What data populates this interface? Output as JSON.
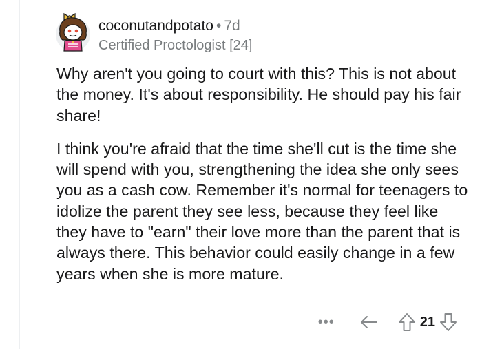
{
  "comment": {
    "username": "coconutandpotato",
    "separator": "•",
    "age": "7d",
    "flair": "Certified Proctologist [24]",
    "paragraphs": [
      "Why aren't you going to court with this? This is not about the money. It's about responsibility. He should pay his fair share!",
      "I think you're afraid that the time she'll cut is the time she will spend with you, strengthening the idea she only sees you as a cash cow. Remember it's normal for teenagers to idolize the parent they see less, because they feel like they have to \"earn\" their love more than the parent that is always there. This behavior could easily change in a few years when she is more mature."
    ],
    "actions": {
      "more_label": "•••",
      "vote_count": "21"
    }
  },
  "icons": {
    "avatar": "snoo-avatar-icon",
    "more": "more-options-icon",
    "reply": "reply-arrow-icon",
    "upvote": "upvote-arrow-icon",
    "downvote": "downvote-arrow-icon"
  },
  "colors": {
    "text": "#1a1a1b",
    "meta": "#787c7e",
    "icon": "#878a8c",
    "thread_line": "#edeff1",
    "avatar_hair": "#6b3f1e",
    "avatar_shirt": "#e24d8e"
  }
}
